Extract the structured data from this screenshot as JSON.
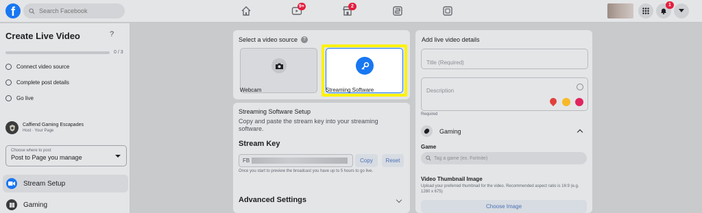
{
  "topbar": {
    "search_placeholder": "Search Facebook",
    "watch_badge": "9+",
    "marketplace_badge": "2",
    "notifications_badge": "1"
  },
  "sidebar": {
    "title": "Create Live Video",
    "help": "?",
    "progress_text": "0 / 3",
    "progress_fraction": 0,
    "steps": [
      "Connect video source",
      "Complete post details",
      "Go live"
    ],
    "page_name": "Caffiend Gaming Escapades",
    "page_sub": "Host · Your Page",
    "post_where_label": "Choose where to post",
    "post_where_value": "Post to Page you manage",
    "items": [
      {
        "label": "Stream Setup",
        "active": true
      },
      {
        "label": "Gaming",
        "active": false
      }
    ]
  },
  "source": {
    "title": "Select a video source",
    "webcam_label": "Webcam",
    "software_label": "Streaming Software"
  },
  "setup": {
    "title": "Streaming Software Setup",
    "description": "Copy and paste the stream key into your streaming software.",
    "stream_key_heading": "Stream Key",
    "key_prefix": "FB",
    "copy_label": "Copy",
    "reset_label": "Reset",
    "key_note": "Once you start to preview the broadcast you have up to 5 hours to go live.",
    "advanced_label": "Advanced Settings"
  },
  "details": {
    "title": "Add live video details",
    "title_placeholder": "Title (Required)",
    "description_placeholder": "Description",
    "required_note": "Required",
    "gaming_label": "Gaming",
    "game_label": "Game",
    "game_placeholder": "Tag a game (ex. Fortnite)",
    "thumbnail_heading": "Video Thumbnail Image",
    "thumbnail_note": "Upload your preferred thumbnail for the video. Recommended aspect ratio is 16:9 (e.g. 1280 x 675)",
    "choose_image_label": "Choose Image"
  },
  "colors": {
    "accent": "#1877f2",
    "highlight": "#fff200",
    "badge": "#e41e3f"
  }
}
